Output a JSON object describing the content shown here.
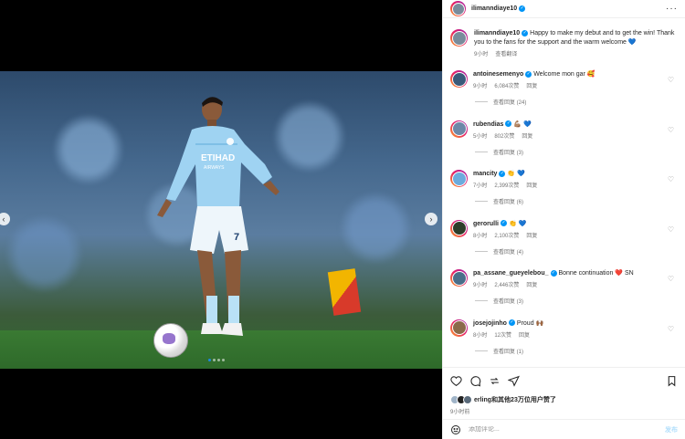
{
  "post": {
    "author": "ilimanndiaye10",
    "more_icon": "more-horizontal-icon",
    "caption": "Happy to make my debut and to get the win! Thank you to the fans for the support and the warm welcome 💙",
    "caption_time": "9小时",
    "see_translation": "查看翻译"
  },
  "carousel": {
    "prev_icon": "chevron-left-icon",
    "next_icon": "chevron-right-icon",
    "prev_glyph": "‹",
    "next_glyph": "›",
    "slide_count": 4,
    "active_slide": 1
  },
  "comments": [
    {
      "user": "antoinesemenyo",
      "text": "Welcome mon gar 🥰",
      "time": "9小时",
      "likes": "6,084次赞",
      "reply": "回复",
      "view_replies": "查看回复 (24)",
      "avatar_color": "#3a5a7a"
    },
    {
      "user": "rubendias",
      "text": "💪🏽 💙",
      "time": "5小时",
      "likes": "802次赞",
      "reply": "回复",
      "view_replies": "查看回复 (3)",
      "avatar_color": "#6d88a8"
    },
    {
      "user": "mancity",
      "text": "👏 💙",
      "time": "7小时",
      "likes": "2,399次赞",
      "reply": "回复",
      "view_replies": "查看回复 (6)",
      "avatar_color": "#6cabdd"
    },
    {
      "user": "gerorulli",
      "text": "👏 💙",
      "time": "8小时",
      "likes": "2,100次赞",
      "reply": "回复",
      "view_replies": "查看回复 (4)",
      "avatar_color": "#2e3d2a"
    },
    {
      "user": "pa_assane_gueyelebou_",
      "text": "Bonne continuation ❤️ SN",
      "time": "9小时",
      "likes": "2,446次赞",
      "reply": "回复",
      "view_replies": "查看回复 (3)",
      "avatar_color": "#4a6e8a"
    },
    {
      "user": "josejojinho",
      "text": "Proud 🙌🏾",
      "time": "8小时",
      "likes": "12次赞",
      "reply": "回复",
      "view_replies": "查看回复 (1)",
      "avatar_color": "#8a6a4a"
    }
  ],
  "actions": {
    "like_icon": "heart-icon",
    "comment_icon": "comment-icon",
    "share_icon": "repost-icon",
    "send_icon": "send-icon",
    "save_icon": "bookmark-icon"
  },
  "likes": {
    "liked_by": "erling",
    "text": "和其他23万位用户赞了",
    "time": "9小时前"
  },
  "composer": {
    "emoji_icon": "emoji-icon",
    "placeholder": "添加评论...",
    "post_label": "发布"
  },
  "colors": {
    "verified": "#0095f6",
    "kit": "#8ec9ef",
    "link": "#0095f6"
  }
}
